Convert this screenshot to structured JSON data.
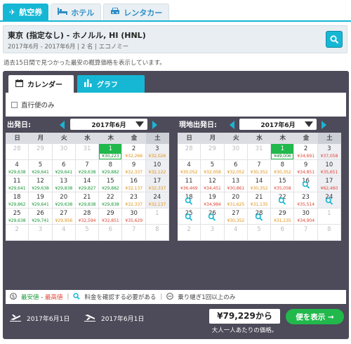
{
  "tabs": [
    {
      "label": "航空券",
      "icon": "plane-icon",
      "active": true
    },
    {
      "label": "ホテル",
      "icon": "bed-icon",
      "active": false
    },
    {
      "label": "レンタカー",
      "icon": "car-icon",
      "active": false
    }
  ],
  "search": {
    "route": "東京 (指定なし) - ホノルル, HI (HNL)",
    "details": "2017年6月 - 2017年6月 | 2 名 | エコノミー"
  },
  "note": "過去15日間で見つかった最安の概算価格を表示しています。",
  "view_tabs": {
    "calendar": "カレンダー",
    "graph": "グラフ"
  },
  "filter": {
    "direct_only": "直行便のみ",
    "checked": false
  },
  "weekdays": [
    "日",
    "月",
    "火",
    "水",
    "木",
    "金",
    "土"
  ],
  "outbound": {
    "label": "出発日:",
    "month": "2017年6月",
    "days": [
      {
        "d": "28",
        "p": "",
        "c": "",
        "o": true
      },
      {
        "d": "29",
        "p": "",
        "c": "",
        "o": true
      },
      {
        "d": "30",
        "p": "",
        "c": "",
        "o": true
      },
      {
        "d": "31",
        "p": "",
        "c": "",
        "o": true
      },
      {
        "d": "1",
        "p": "¥30,223",
        "c": "green",
        "hl": true
      },
      {
        "d": "2",
        "p": "¥32,266",
        "c": "orange"
      },
      {
        "d": "3",
        "p": "¥32,026",
        "c": "orange"
      },
      {
        "d": "4",
        "p": "¥29,638",
        "c": "green"
      },
      {
        "d": "5",
        "p": "¥29,641",
        "c": "green"
      },
      {
        "d": "6",
        "p": "¥29,641",
        "c": "green"
      },
      {
        "d": "7",
        "p": "¥29,638",
        "c": "green"
      },
      {
        "d": "8",
        "p": "¥29,882",
        "c": "green"
      },
      {
        "d": "9",
        "p": "¥32,337",
        "c": "orange"
      },
      {
        "d": "10",
        "p": "¥32,122",
        "c": "orange"
      },
      {
        "d": "11",
        "p": "¥29,641",
        "c": "green"
      },
      {
        "d": "12",
        "p": "¥29,638",
        "c": "green"
      },
      {
        "d": "13",
        "p": "¥29,838",
        "c": "green"
      },
      {
        "d": "14",
        "p": "¥29,827",
        "c": "green"
      },
      {
        "d": "15",
        "p": "¥29,882",
        "c": "green"
      },
      {
        "d": "16",
        "p": "¥32,137",
        "c": "orange"
      },
      {
        "d": "17",
        "p": "¥32,337",
        "c": "orange"
      },
      {
        "d": "18",
        "p": "¥29,862",
        "c": "green"
      },
      {
        "d": "19",
        "p": "¥29,641",
        "c": "green"
      },
      {
        "d": "20",
        "p": "¥29,638",
        "c": "green"
      },
      {
        "d": "21",
        "p": "¥29,838",
        "c": "green"
      },
      {
        "d": "22",
        "p": "¥29,838",
        "c": "green"
      },
      {
        "d": "23",
        "p": "¥32,337",
        "c": "orange"
      },
      {
        "d": "24",
        "p": "¥32,137",
        "c": "orange"
      },
      {
        "d": "25",
        "p": "¥29,638",
        "c": "green"
      },
      {
        "d": "26",
        "p": "¥29,741",
        "c": "green"
      },
      {
        "d": "27",
        "p": "¥29,956",
        "c": "orange"
      },
      {
        "d": "28",
        "p": "¥32,594",
        "c": "red"
      },
      {
        "d": "29",
        "p": "¥32,851",
        "c": "red"
      },
      {
        "d": "30",
        "p": "¥35,629",
        "c": "red"
      },
      {
        "d": "1",
        "p": "",
        "c": "",
        "o": true
      },
      {
        "d": "2",
        "p": "",
        "c": "",
        "o": true
      },
      {
        "d": "3",
        "p": "",
        "c": "",
        "o": true
      },
      {
        "d": "4",
        "p": "",
        "c": "",
        "o": true
      },
      {
        "d": "5",
        "p": "",
        "c": "",
        "o": true
      },
      {
        "d": "6",
        "p": "",
        "c": "",
        "o": true
      },
      {
        "d": "7",
        "p": "",
        "c": "",
        "o": true
      },
      {
        "d": "8",
        "p": "",
        "c": "",
        "o": true
      }
    ]
  },
  "return": {
    "label": "現地出発日:",
    "month": "2017年6月",
    "days": [
      {
        "d": "28",
        "p": "",
        "c": "",
        "o": true
      },
      {
        "d": "29",
        "p": "",
        "c": "",
        "o": true
      },
      {
        "d": "30",
        "p": "",
        "c": "",
        "o": true
      },
      {
        "d": "31",
        "p": "",
        "c": "",
        "o": true
      },
      {
        "d": "1",
        "p": "¥49,006",
        "c": "green",
        "hl": true
      },
      {
        "d": "2",
        "p": "¥34,691",
        "c": "red"
      },
      {
        "d": "3",
        "p": "¥37,058",
        "c": "red"
      },
      {
        "d": "4",
        "p": "¥30,052",
        "c": "orange"
      },
      {
        "d": "5",
        "p": "¥32,058",
        "c": "orange"
      },
      {
        "d": "6",
        "p": "¥32,052",
        "c": "orange"
      },
      {
        "d": "7",
        "p": "¥30,352",
        "c": "orange"
      },
      {
        "d": "8",
        "p": "¥30,352",
        "c": "orange"
      },
      {
        "d": "9",
        "p": "¥34,851",
        "c": "red"
      },
      {
        "d": "10",
        "p": "¥35,651",
        "c": "red"
      },
      {
        "d": "11",
        "p": "¥36,469",
        "c": "red"
      },
      {
        "d": "12",
        "p": "¥34,451",
        "c": "red"
      },
      {
        "d": "13",
        "p": "¥30,861",
        "c": "red"
      },
      {
        "d": "14",
        "p": "¥30,352",
        "c": "orange"
      },
      {
        "d": "15",
        "p": "¥35,058",
        "c": "red"
      },
      {
        "d": "16",
        "p": "",
        "c": "",
        "m": true
      },
      {
        "d": "17",
        "p": "¥62,460",
        "c": "red"
      },
      {
        "d": "18",
        "p": "",
        "c": "",
        "m": true
      },
      {
        "d": "19",
        "p": "¥34,984",
        "c": "red"
      },
      {
        "d": "20",
        "p": "¥31,625",
        "c": "orange"
      },
      {
        "d": "21",
        "p": "¥31,135",
        "c": "orange"
      },
      {
        "d": "22",
        "p": "",
        "c": "",
        "m": true
      },
      {
        "d": "23",
        "p": "¥35,514",
        "c": "red"
      },
      {
        "d": "24",
        "p": "",
        "c": "",
        "m": true
      },
      {
        "d": "25",
        "p": "",
        "c": "",
        "m": true
      },
      {
        "d": "26",
        "p": "",
        "c": "",
        "m": true
      },
      {
        "d": "27",
        "p": "¥30,352",
        "c": "orange"
      },
      {
        "d": "28",
        "p": "",
        "c": "",
        "m": true
      },
      {
        "d": "29",
        "p": "¥31,135",
        "c": "orange"
      },
      {
        "d": "30",
        "p": "¥34,904",
        "c": "red"
      },
      {
        "d": "1",
        "p": "",
        "c": "",
        "o": true
      },
      {
        "d": "2",
        "p": "",
        "c": "",
        "o": true
      },
      {
        "d": "3",
        "p": "",
        "c": "",
        "o": true
      },
      {
        "d": "4",
        "p": "",
        "c": "",
        "o": true
      },
      {
        "d": "5",
        "p": "",
        "c": "",
        "o": true
      },
      {
        "d": "6",
        "p": "",
        "c": "",
        "o": true
      },
      {
        "d": "7",
        "p": "",
        "c": "",
        "o": true
      },
      {
        "d": "8",
        "p": "",
        "c": "",
        "o": true
      }
    ]
  },
  "legend": {
    "cheapest": "最安値",
    "dash": "-",
    "highest": "最高値",
    "check_price": "料金を確認する必要がある",
    "transfer": "乗り継ぎ1回以上のみ"
  },
  "footer": {
    "depart_date": "2017年6月1日",
    "return_date": "2017年6月1日",
    "price": "¥79,229から",
    "price_sub": "大人一人あたりの価格。",
    "show_button": "便を表示 →"
  },
  "colors": {
    "accent": "#16b7d4",
    "green": "#21b84c",
    "panel": "#4d4a59"
  }
}
